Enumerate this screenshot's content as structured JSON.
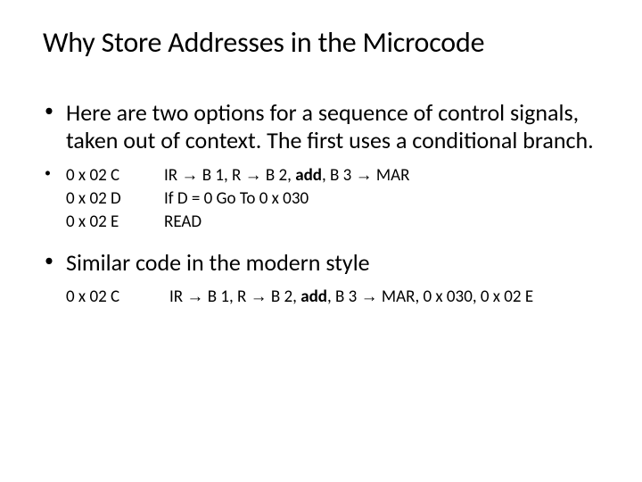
{
  "title": "Why Store Addresses in the Microcode",
  "bullets": {
    "b1": "Here are two options for a sequence of control signals, taken out of context.  The first uses a conditional branch.",
    "b3": "Similar code in the modern style"
  },
  "code1": {
    "addr": [
      "0 x 02 C",
      "0 x 02 D",
      "0 x 02 E"
    ],
    "instr_pre": "IR ",
    "instr_b1": " B 1, R ",
    "instr_b2": " B 2, ",
    "instr_add": "add",
    "instr_b3": ", B 3 ",
    "instr_mar": " MAR",
    "line2": "If D = 0 Go To 0 x 030",
    "line3": "READ"
  },
  "code2": {
    "addr": "0 x 02 C",
    "instr_pre": "IR ",
    "instr_b1": " B 1, R ",
    "instr_b2": " B 2, ",
    "instr_add": "add",
    "instr_b3": ", B 3 ",
    "instr_mar": " MAR, 0 x 030, 0 x 02 E"
  },
  "glyphs": {
    "arrow": "→"
  }
}
